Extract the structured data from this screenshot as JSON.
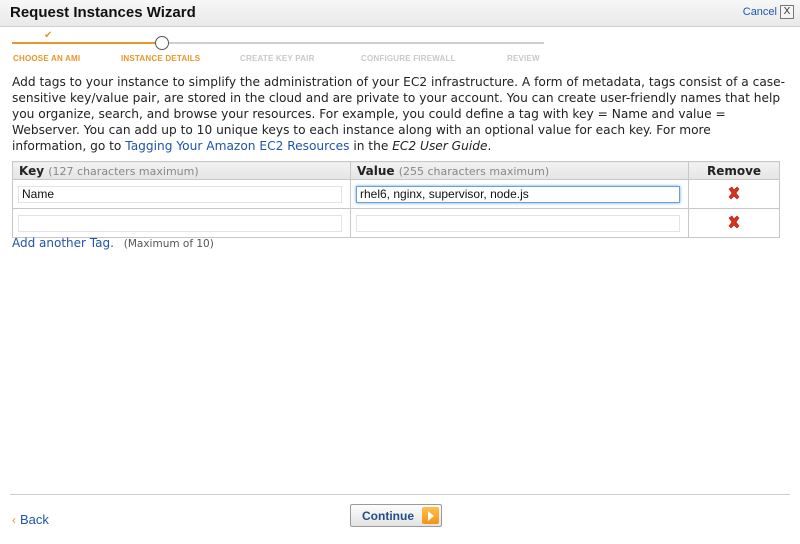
{
  "window": {
    "title": "Request Instances Wizard",
    "cancel_label": "Cancel",
    "close_glyph": "X"
  },
  "steps": [
    {
      "label": "CHOOSE AN AMI",
      "state": "done"
    },
    {
      "label": "INSTANCE DETAILS",
      "state": "current"
    },
    {
      "label": "CREATE KEY PAIR",
      "state": "pending"
    },
    {
      "label": "CONFIGURE FIREWALL",
      "state": "pending"
    },
    {
      "label": "REVIEW",
      "state": "pending"
    }
  ],
  "description": {
    "text": "Add tags to your instance to simplify the administration of your EC2 infrastructure. A form of metadata, tags consist of a case-sensitive key/value pair, are stored in the cloud and are private to your account. You can create user-friendly names that help you organize, search, and browse your resources. For example, you could define a tag with key = Name and value = Webserver. You can add up to 10 unique keys to each instance along with an optional value for each key. For more information, go to ",
    "link": "Tagging Your Amazon EC2 Resources",
    "middle": " in the ",
    "guide": "EC2 User Guide",
    "end": "."
  },
  "table": {
    "key_header": "Key",
    "key_hint": "(127 characters maximum)",
    "value_header": "Value",
    "value_hint": "(255 characters maximum)",
    "remove_header": "Remove",
    "rows": [
      {
        "key": "Name",
        "value": "rhel6, nginx, supervisor, node.js"
      },
      {
        "key": "",
        "value": ""
      }
    ]
  },
  "add_tag": {
    "link": "Add another Tag.",
    "note": "(Maximum of 10)"
  },
  "footer": {
    "back_chevron": "‹",
    "back_label": "Back",
    "continue_label": "Continue"
  },
  "colors": {
    "accent_orange": "#e8962c",
    "link_blue": "#1f55a6",
    "remove_red": "#d6321e"
  },
  "icons": {
    "remove": "remove-x-icon",
    "continue": "arrow-right-icon",
    "step_done": "check-icon"
  }
}
